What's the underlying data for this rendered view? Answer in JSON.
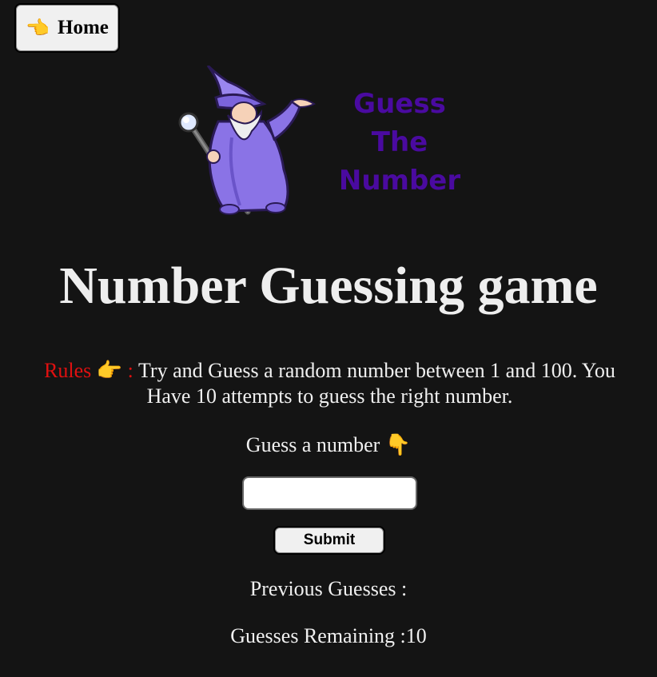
{
  "nav": {
    "home_icon": "👈",
    "home_label": "Home"
  },
  "logo": {
    "line1": "Guess",
    "line2": "The",
    "line3": "Number",
    "text_color": "#4a0aa0"
  },
  "title": "Number Guessing game",
  "rules": {
    "label": "Rules",
    "label_icon": "👉",
    "separator": ":",
    "text": "Try and Guess a random number between 1 and 100. You Have 10 attempts to guess the right number.",
    "label_color": "#e01010"
  },
  "guess": {
    "label": "Guess a number",
    "label_icon": "👇",
    "input_value": "",
    "submit_label": "Submit"
  },
  "status": {
    "previous_guesses": "Previous Guesses :",
    "remaining_label": "Guesses Remaining :",
    "remaining_value": "10"
  },
  "colors": {
    "background": "#141414",
    "text": "#eeeeee"
  }
}
